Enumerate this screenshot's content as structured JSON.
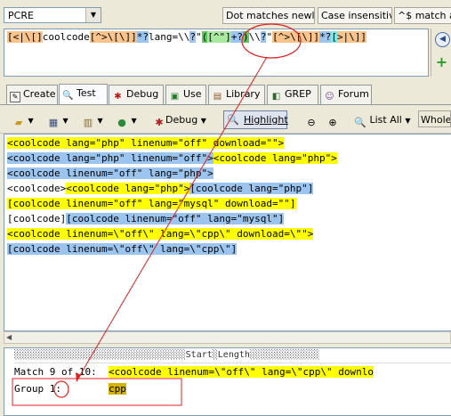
{
  "options": {
    "flavor": "PCRE",
    "dot_matches_newline": "Dot matches newline",
    "case_insensitive": "Case insensitive",
    "match_at": "^$ match at"
  },
  "regex_tokens": [
    {
      "text": "[<|\\[]",
      "style": "or"
    },
    {
      "text": "coolcode",
      "style": ""
    },
    {
      "text": "[^>\\[\\]]",
      "style": "or"
    },
    {
      "text": "*?",
      "style": "bl"
    },
    {
      "text": "lang=\\\\",
      "style": ""
    },
    {
      "text": "?",
      "style": "bl"
    },
    {
      "text": "\"",
      "style": ""
    },
    {
      "text": "(",
      "style": "grd"
    },
    {
      "text": "[^\"]",
      "style": "gr"
    },
    {
      "text": "+?",
      "style": "bl"
    },
    {
      "text": ")",
      "style": "grd"
    },
    {
      "text": "\\\\",
      "style": ""
    },
    {
      "text": "?",
      "style": "bl"
    },
    {
      "text": "\"",
      "style": ""
    },
    {
      "text": "[^>\\[\\]]",
      "style": "or"
    },
    {
      "text": "*?",
      "style": "bl"
    },
    {
      "text": "[",
      "style": "cy"
    },
    {
      "text": ">|\\]]",
      "style": "or"
    }
  ],
  "tabs": [
    {
      "label": "Create",
      "icon": "create-icon"
    },
    {
      "label": "Test",
      "icon": "magnifier-icon"
    },
    {
      "label": "Debug",
      "icon": "bug-icon"
    },
    {
      "label": "Use",
      "icon": "use-icon"
    },
    {
      "label": "Library",
      "icon": "library-icon"
    },
    {
      "label": "GREP",
      "icon": "grep-icon"
    },
    {
      "label": "Forum",
      "icon": "forum-icon"
    }
  ],
  "toolbar": {
    "debug": "Debug",
    "highlight": "Highlight",
    "list_all": "List All",
    "whole": "Whole l"
  },
  "test_lines": [
    [
      {
        "t": "<coolcode lang=\"php\" linenum=\"off\" download=\"\">",
        "h": "y"
      }
    ],
    [
      {
        "t": "<coolcode lang=\"php\" linenum=\"off\">",
        "h": "b"
      },
      {
        "t": "<coolcode lang=\"php\">",
        "h": "y"
      }
    ],
    [
      {
        "t": "<coolcode linenum=\"off\" lang=\"php\">",
        "h": "b"
      }
    ],
    [
      {
        "t": "<coolcode>",
        "h": ""
      },
      {
        "t": "<coolcode lang=\"php\">",
        "h": "y"
      },
      {
        "t": "[coolcode lang=\"php\"]",
        "h": "b"
      }
    ],
    [
      {
        "t": "[coolcode linenum=\"off\" lang=\"mysql\" download=\"\"]",
        "h": "y"
      }
    ],
    [
      {
        "t": "[coolcode]",
        "h": ""
      },
      {
        "t": "[coolcode linenum=\"off\" lang=\"mysql\"]",
        "h": "b"
      }
    ],
    [
      {
        "t": "<coolcode linenum=\\\"off\\\" lang=\\\"cpp\\\" download=\\\"\">",
        "h": "y"
      }
    ],
    [
      {
        "t": "[coolcode linenum=\\\"off\\\" lang=\\\"cpp\\\"]",
        "h": "b"
      }
    ]
  ],
  "results": {
    "header": "░░░░░░░░░░░░░░░░░░░░░░░░░░░░░░░░Start░Length░░░░░░░░░░░░░",
    "match_label": "Match 9 of 10:",
    "match_value": "<coolcode linenum=\\\"off\\\" lang=\\\"cpp\\\" downlo",
    "group_label": "Group 1:",
    "group_value": "cpp"
  }
}
